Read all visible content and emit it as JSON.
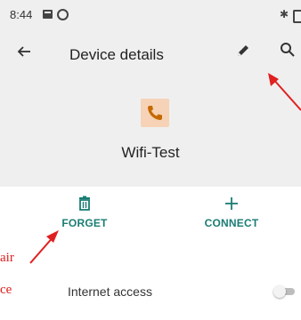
{
  "status_bar": {
    "time": "8:44",
    "bluetooth_glyph": "✱"
  },
  "header": {
    "title": "Device details",
    "back_icon": "arrow-left",
    "edit_icon": "pencil",
    "search_icon": "magnifier"
  },
  "device": {
    "name": "Wifi-Test",
    "icon": "phone",
    "icon_bg": "#f6d2b6",
    "icon_color": "#c46a00"
  },
  "actions": {
    "forget_label": "FORGET",
    "connect_label": "CONNECT",
    "accent": "#1a7d74"
  },
  "settings": {
    "internet_access_label": "Internet access",
    "internet_access_enabled": false
  },
  "annotations": {
    "text_1": "air",
    "text_2": "ce",
    "color": "#e02020"
  }
}
